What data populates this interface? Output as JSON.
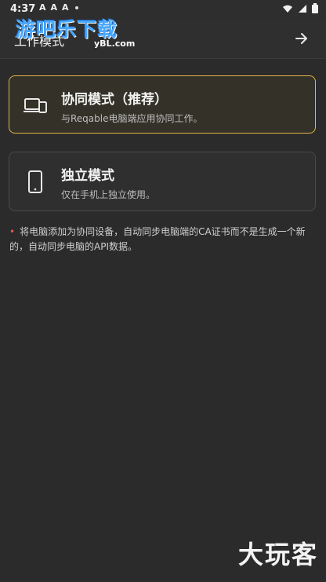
{
  "status_bar": {
    "time": "4:37",
    "left_icons": [
      "A",
      "A",
      "A"
    ],
    "signal_icon": "signal-icon",
    "wifi_icon": "wifi-icon",
    "battery_icon": "battery-icon"
  },
  "app_bar": {
    "title": "工作模式",
    "next_icon": "arrow-right-icon"
  },
  "watermark": {
    "main": "游吧乐下载",
    "sub": "yBL.com"
  },
  "cards": [
    {
      "title": "协同模式（推荐）",
      "description": "与Reqable电脑端应用协同工作。",
      "icon": "devices-icon",
      "selected": true
    },
    {
      "title": "独立模式",
      "description": "仅在手机上独立使用。",
      "icon": "phone-icon",
      "selected": false
    }
  ],
  "note": {
    "bullet": "•",
    "text": "将电脑添加为协同设备，自动同步电脑端的CA证书而不是生成一个新的，自动同步电脑的API数据。"
  },
  "corner_watermark": "大玩客",
  "colors": {
    "background": "#2b2b2b",
    "selected_border": "#e2b44a",
    "bullet": "#e05a4a"
  }
}
